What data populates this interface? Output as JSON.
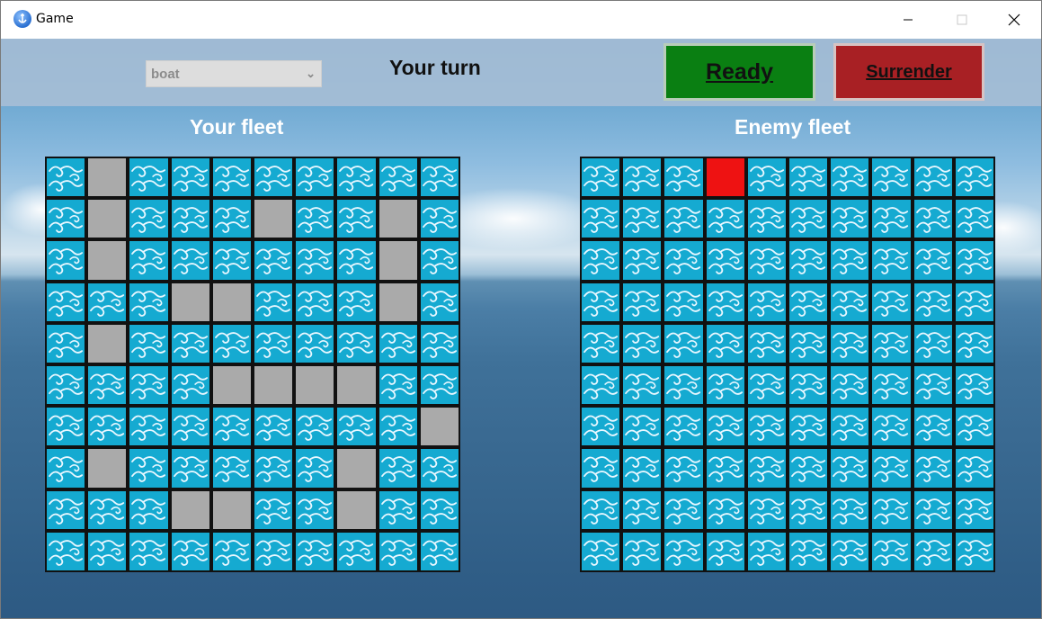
{
  "window": {
    "title": "Game"
  },
  "controls": {
    "selected_piece": "boat",
    "turn_status": "Your turn",
    "ready_label": "Ready",
    "surrender_label": "Surrender"
  },
  "colors": {
    "water": "#15aad1",
    "ship": "#aaaaaa",
    "hit": "#ee1212",
    "ready": "#0a7f12",
    "surrender": "#a82024"
  },
  "your_fleet": {
    "title": "Your fleet",
    "grid": [
      "WSWWWWWWWW",
      "WSWWWSWWSW",
      "WSWWWWWWSW",
      "WWWSSWWWSW",
      "WSWWWWWWWW",
      "WWWWSSSSWW",
      "WWWWWWWWWS",
      "WSWWWWWSWW",
      "WWWSSWWSWW",
      "WWWWWWWWWW"
    ]
  },
  "enemy_fleet": {
    "title": "Enemy fleet",
    "grid": [
      "WWWHWWWWWW",
      "WWWWWWWWWW",
      "WWWWWWWWWW",
      "WWWWWWWWWW",
      "WWWWWWWWWW",
      "WWWWWWWWWW",
      "WWWWWWWWWW",
      "WWWWWWWWWW",
      "WWWWWWWWWW",
      "WWWWWWWWWW"
    ]
  }
}
